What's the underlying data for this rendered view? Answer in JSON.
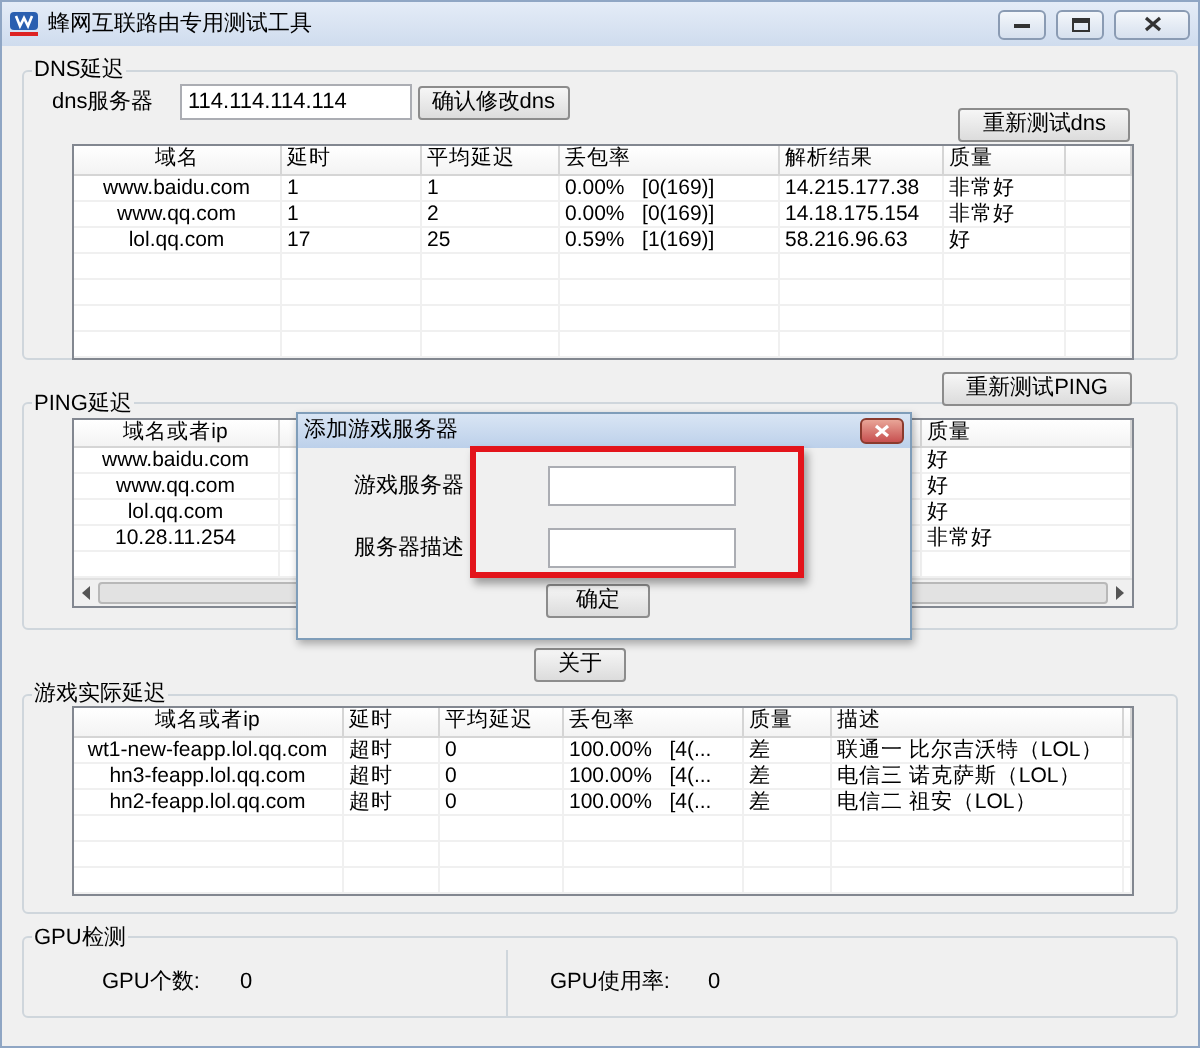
{
  "window": {
    "title": "蜂网互联路由专用测试工具"
  },
  "dns": {
    "title": "DNS延迟",
    "server_label": "dns服务器",
    "server_value": "114.114.114.114",
    "confirm_button": "确认修改dns",
    "retest_button": "重新测试dns",
    "table": {
      "columns": [
        "域名",
        "延时",
        "平均延迟",
        "丢包率",
        "解析结果",
        "质量"
      ],
      "rows": [
        [
          "www.baidu.com",
          "1",
          "1",
          "0.00%   [0(169)]",
          "14.215.177.38",
          "非常好"
        ],
        [
          "www.qq.com",
          "1",
          "2",
          "0.00%   [0(169)]",
          "14.18.175.154",
          "非常好"
        ],
        [
          "lol.qq.com",
          "17",
          "25",
          "0.59%   [1(169)]",
          "58.216.96.63",
          "好"
        ]
      ]
    }
  },
  "ping": {
    "title": "PING延迟",
    "retest_button": "重新测试PING",
    "table": {
      "columns": [
        "域名或者ip",
        null,
        "质量"
      ],
      "rows": [
        [
          "www.baidu.com",
          null,
          "好"
        ],
        [
          "www.qq.com",
          null,
          "好"
        ],
        [
          "lol.qq.com",
          null,
          "好"
        ],
        [
          "10.28.11.254",
          null,
          "非常好"
        ]
      ]
    }
  },
  "about_button": "关于",
  "game": {
    "title": "游戏实际延迟",
    "table": {
      "columns": [
        "域名或者ip",
        "延时",
        "平均延迟",
        "丢包率",
        "质量",
        "描述"
      ],
      "rows": [
        [
          "wt1-new-feapp.lol.qq.com",
          "超时",
          "0",
          "100.00%   [4(...",
          "差",
          "联通一 比尔吉沃特（LOL）"
        ],
        [
          "hn3-feapp.lol.qq.com",
          "超时",
          "0",
          "100.00%   [4(...",
          "差",
          "电信三 诺克萨斯（LOL）"
        ],
        [
          "hn2-feapp.lol.qq.com",
          "超时",
          "0",
          "100.00%   [4(...",
          "差",
          "电信二 祖安（LOL）"
        ]
      ]
    }
  },
  "gpu": {
    "title": "GPU检测",
    "count_label": "GPU个数:",
    "count_value": "0",
    "usage_label": "GPU使用率:",
    "usage_value": "0"
  },
  "dialog": {
    "title": "添加游戏服务器",
    "highlighted": true,
    "fields": [
      {
        "label": "游戏服务器"
      },
      {
        "label": "服务器描述"
      }
    ],
    "ok_button": "确定"
  }
}
